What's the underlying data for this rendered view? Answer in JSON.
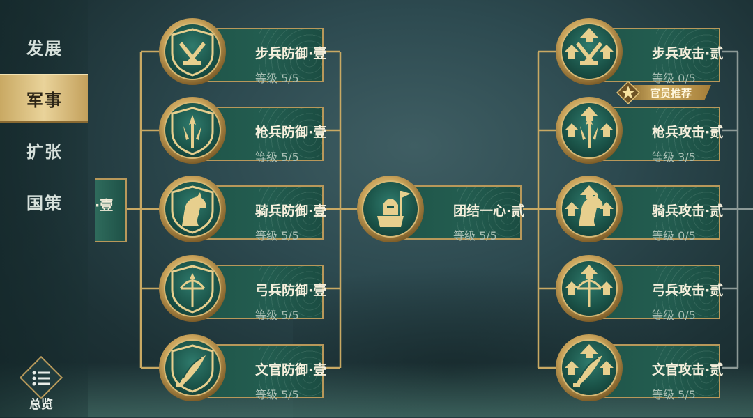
{
  "menu": {
    "items": [
      {
        "label": "发展",
        "active": false
      },
      {
        "label": "军事",
        "active": true
      },
      {
        "label": "扩张",
        "active": false
      },
      {
        "label": "国策",
        "active": false
      }
    ],
    "overview_label": "总览"
  },
  "partial_node": {
    "label": "·壹"
  },
  "defense": [
    {
      "name": "步兵防御·壹",
      "level": "等级 5/5",
      "icon": "sword-shield-icon"
    },
    {
      "name": "枪兵防御·壹",
      "level": "等级 5/5",
      "icon": "spear-shield-icon"
    },
    {
      "name": "骑兵防御·壹",
      "level": "等级 5/5",
      "icon": "horse-shield-icon"
    },
    {
      "name": "弓兵防御·壹",
      "level": "等级 5/5",
      "icon": "bow-shield-icon"
    },
    {
      "name": "文官防御·壹",
      "level": "等级 5/5",
      "icon": "feather-shield-icon"
    }
  ],
  "center": {
    "name": "团结一心·贰",
    "level": "等级 5/5",
    "icon": "helmet-banner-icon"
  },
  "attack": [
    {
      "name": "步兵攻击·贰",
      "level": "等级 0/5",
      "icon": "sword-arrows-icon"
    },
    {
      "name": "枪兵攻击·贰",
      "level": "等级 3/5",
      "icon": "spear-arrows-icon"
    },
    {
      "name": "骑兵攻击·贰",
      "level": "等级 0/5",
      "icon": "horse-arrows-icon"
    },
    {
      "name": "弓兵攻击·贰",
      "level": "等级 0/5",
      "icon": "bow-arrows-icon"
    },
    {
      "name": "文官攻击·贰",
      "level": "等级 5/5",
      "icon": "feather-arrows-icon"
    }
  ],
  "recommend_badge": "官员推荐",
  "colors": {
    "gold": "#b8985a",
    "card": "#235d50",
    "active_tab": "#e9d39a"
  }
}
